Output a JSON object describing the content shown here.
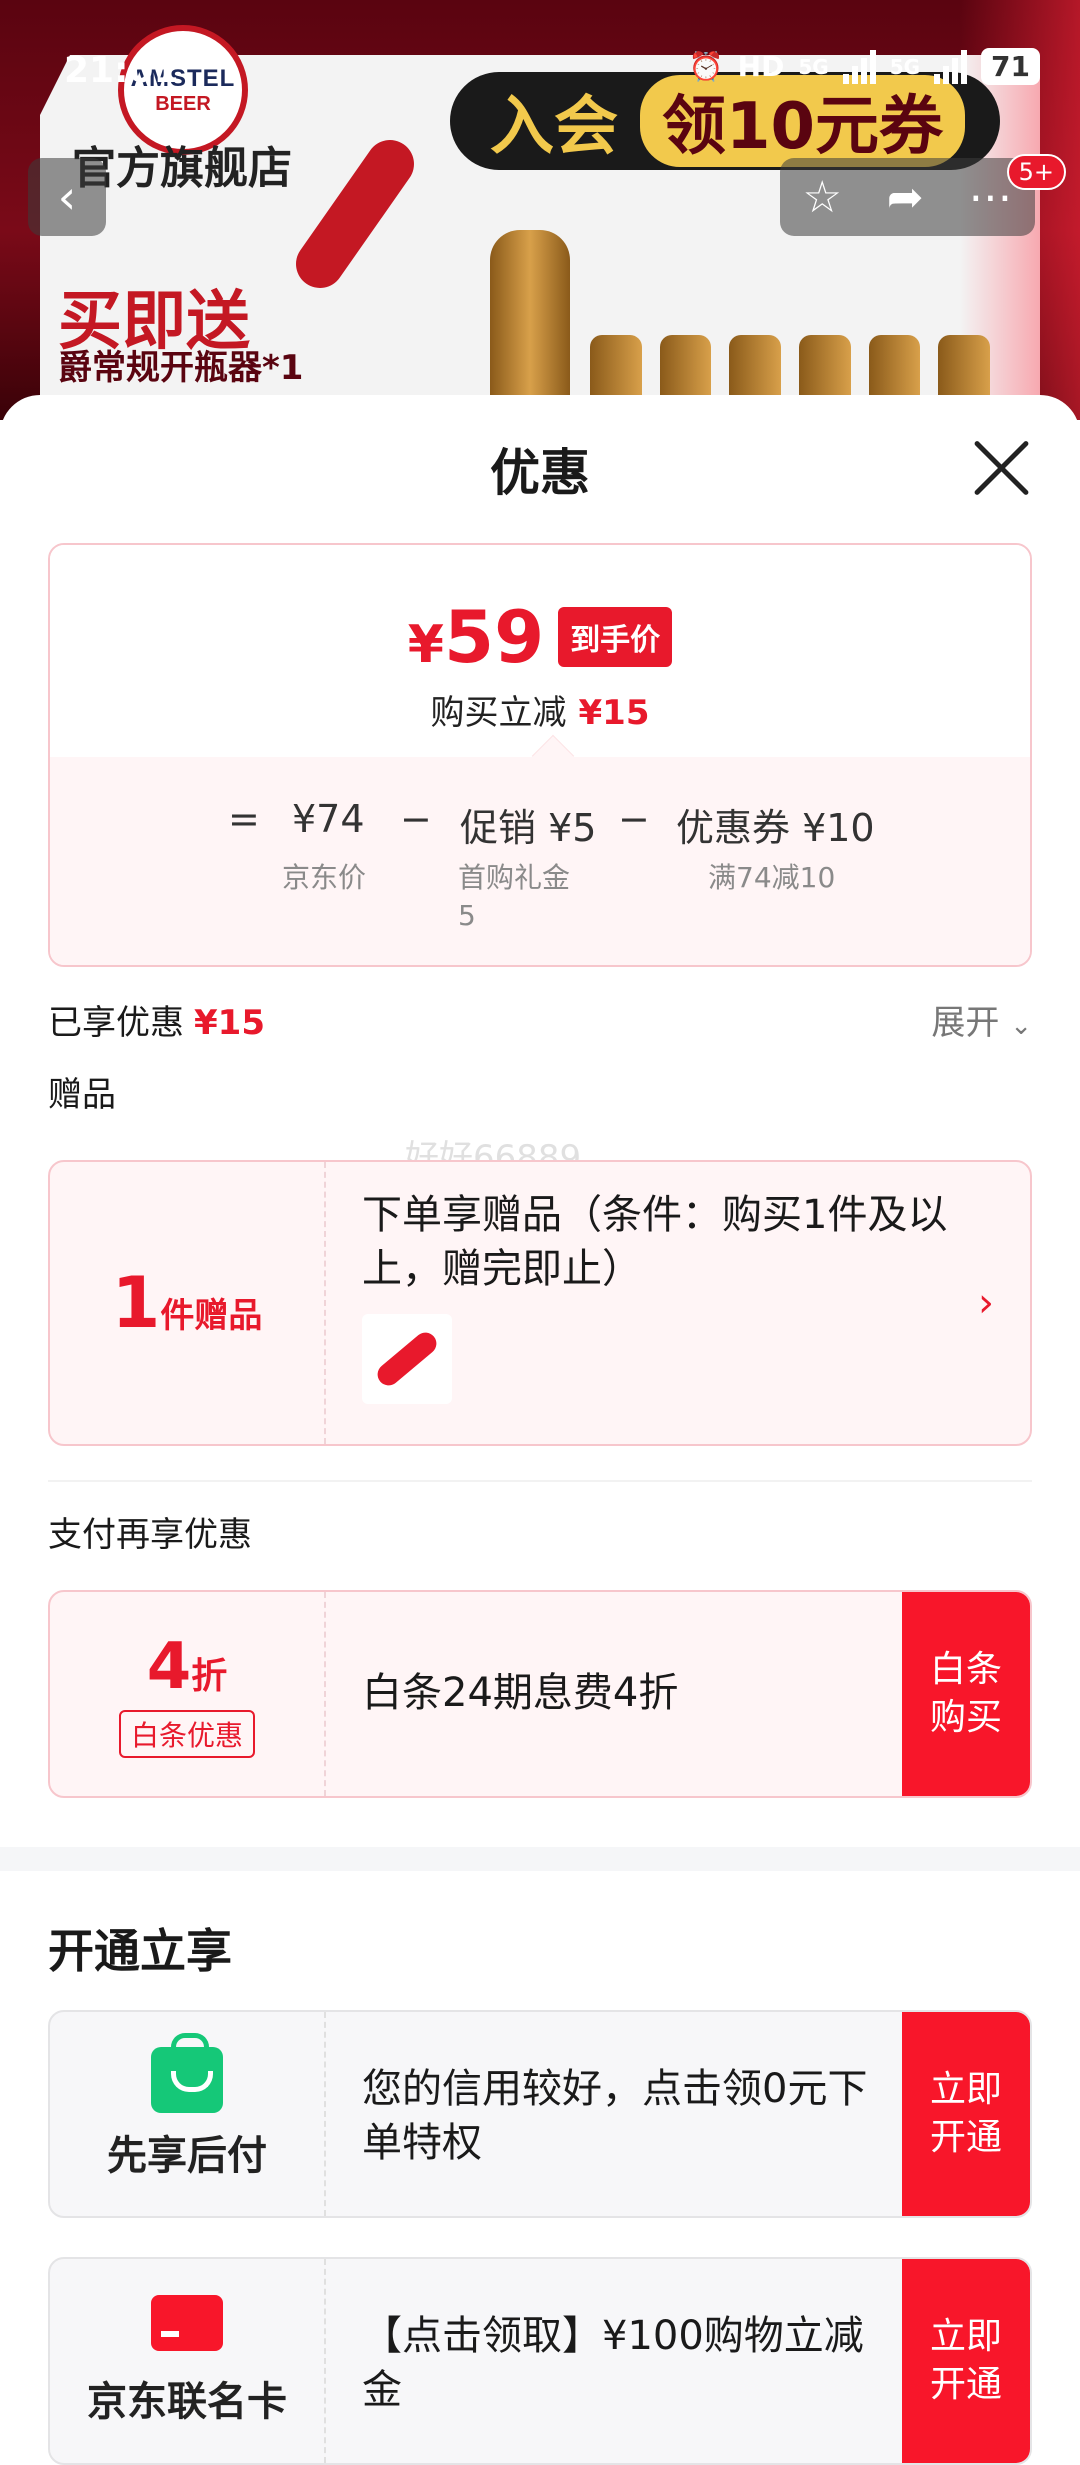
{
  "status_bar": {
    "time": "21:01",
    "hd": "HD",
    "net1": "5G",
    "net2": "5G",
    "battery": "71"
  },
  "header_image": {
    "brand_top": "AMSTEL",
    "brand_bottom": "BEER",
    "store_name": "官方旗舰店",
    "promo_prefix": "入会",
    "promo_highlight": "领10元券",
    "gift_headline": "买即送",
    "gift_sub": "爵常规开瓶器*1",
    "notification_badge": "5+"
  },
  "sheet": {
    "title": "优惠",
    "price": {
      "currency": "¥",
      "final_amount": "59",
      "final_tag": "到手价",
      "saving_label": "购买立减",
      "saving_value": "¥15",
      "eq_sign": "=",
      "minus": "−",
      "jd_price_value": "¥74",
      "jd_price_label": "京东价",
      "promo_label": "促销 ¥5",
      "promo_sub1": "首购礼金",
      "promo_sub2": "5",
      "coupon_label": "优惠券 ¥10",
      "coupon_sub": "满74减10"
    },
    "enjoyed_label": "已享优惠",
    "enjoyed_value": "¥15",
    "expand_label": "展开",
    "gift_section_label": "赠品",
    "watermark": "好好66889",
    "gift_card": {
      "count": "1",
      "unit": "件赠品",
      "desc": "下单享赠品（条件：购买1件及以上，赠完即止）"
    },
    "pay_section_label": "支付再享优惠",
    "pay_card": {
      "discount_num": "4",
      "discount_unit": "折",
      "tag": "白条优惠",
      "desc": "白条24期息费4折",
      "cta": "白条购买"
    },
    "open_section_title": "开通立享",
    "credit_card": {
      "name": "先享后付",
      "desc": "您的信用较好，点击领0元下单特权",
      "cta": "立即开通"
    },
    "jd_card": {
      "name": "京东联名卡",
      "desc": "【点击领取】¥100购物立减金",
      "cta": "立即开通"
    }
  },
  "colors": {
    "accent": "#e8192c",
    "cta": "#f8162a",
    "green": "#15c878"
  }
}
